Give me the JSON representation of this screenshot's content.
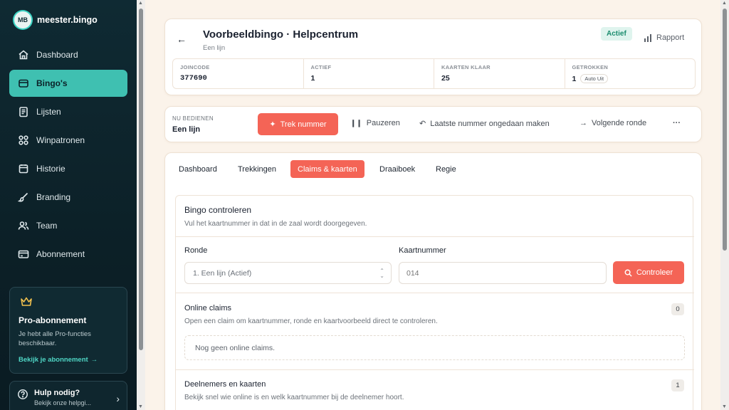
{
  "brand": {
    "logo_text": "MB",
    "name": "meester.bingo"
  },
  "sidebar": {
    "items": [
      {
        "label": "Dashboard",
        "icon": "home-icon"
      },
      {
        "label": "Bingo's",
        "icon": "ticket-icon",
        "active": true
      },
      {
        "label": "Lijsten",
        "icon": "list-icon"
      },
      {
        "label": "Winpatronen",
        "icon": "grid-icon"
      },
      {
        "label": "Historie",
        "icon": "history-icon"
      },
      {
        "label": "Branding",
        "icon": "brush-icon"
      },
      {
        "label": "Team",
        "icon": "users-icon"
      },
      {
        "label": "Abonnement",
        "icon": "card-icon"
      }
    ],
    "pro": {
      "title": "Pro-abonnement",
      "desc": "Je hebt alle Pro-functies beschikbaar.",
      "link": "Bekijk je abonnement"
    },
    "help": {
      "title": "Hulp nodig?",
      "sub": "Bekijk onze helpgi..."
    }
  },
  "header": {
    "title": "Voorbeeldbingo · Helpcentrum",
    "subtitle": "Een lijn",
    "status": "Actief",
    "rapport": "Rapport",
    "stats": [
      {
        "label": "JOINCODE",
        "value": "377690"
      },
      {
        "label": "ACTIEF",
        "value": "1"
      },
      {
        "label": "KAARTEN KLAAR",
        "value": "25"
      },
      {
        "label": "GETROKKEN",
        "value": "1",
        "chip": "Auto Uit"
      }
    ]
  },
  "actions": {
    "now_label": "NU BEDIENEN",
    "now_value": "Een lijn",
    "draw": "Trek nummer",
    "pause": "Pauzeren",
    "undo": "Laatste nummer ongedaan maken",
    "next": "Volgende ronde",
    "more": "···"
  },
  "tabs": [
    "Dashboard",
    "Trekkingen",
    "Claims & kaarten",
    "Draaiboek",
    "Regie"
  ],
  "active_tab": "Claims & kaarten",
  "check": {
    "title": "Bingo controleren",
    "desc": "Vul het kaartnummer in dat in de zaal wordt doorgegeven.",
    "round_label": "Ronde",
    "round_value": "1. Een lijn (Actief)",
    "card_label": "Kaartnummer",
    "card_placeholder": "014",
    "submit": "Controleer"
  },
  "online": {
    "title": "Online claims",
    "count": "0",
    "desc": "Open een claim om kaartnummer, ronde en kaartvoorbeeld direct te controleren.",
    "empty": "Nog geen online claims."
  },
  "participants": {
    "title": "Deelnemers en kaarten",
    "count": "1",
    "desc": "Bekijk snel wie online is en welk kaartnummer bij de deelnemer hoort."
  },
  "colors": {
    "accent": "#f46456",
    "sidebar": "#0f2a33",
    "active_nav": "#3fc0b1",
    "status_green": "#1b8c6e"
  }
}
